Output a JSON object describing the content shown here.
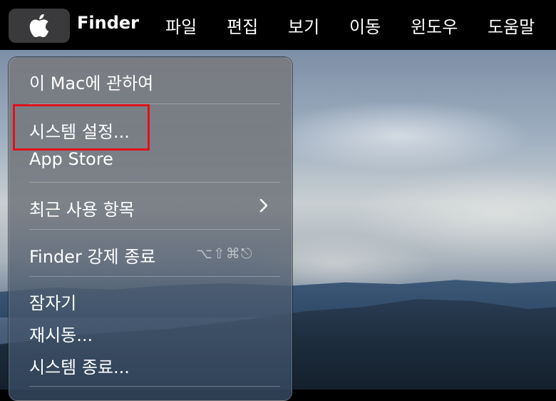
{
  "menubar": {
    "app_name": "Finder",
    "menus": [
      "파일",
      "편집",
      "보기",
      "이동",
      "윈도우",
      "도움말"
    ]
  },
  "apple_menu": {
    "items": {
      "about": "이 Mac에 관하여",
      "system_settings": "시스템 설정...",
      "app_store": "App Store",
      "recent_items": "최근 사용 항목",
      "force_quit": "Finder 강제 종료",
      "force_quit_shortcut": "⌥⇧⌘⎋",
      "sleep": "잠자기",
      "restart": "재시동...",
      "shutdown": "시스템 종료..."
    }
  },
  "colors": {
    "highlight_border": "#e0121a"
  },
  "icons": {
    "apple": "apple-logo-icon",
    "submenu": "chevron-right-icon"
  }
}
